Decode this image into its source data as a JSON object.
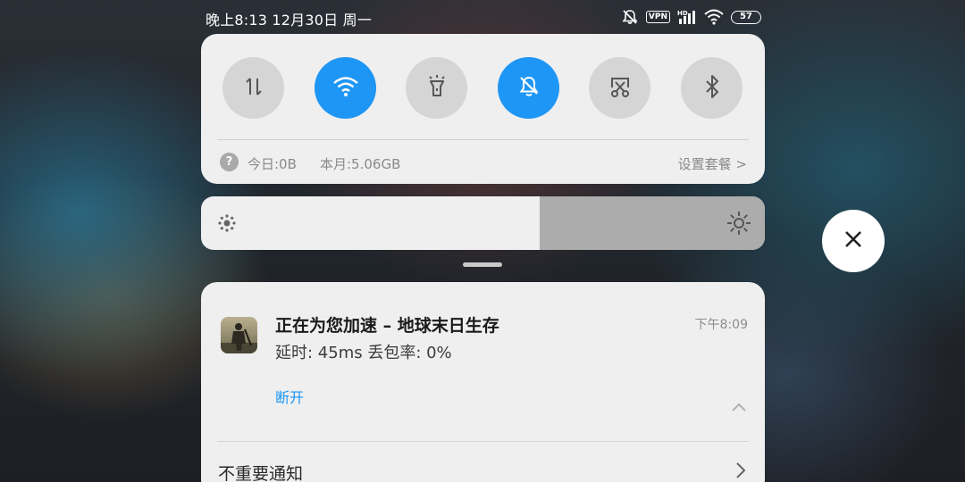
{
  "status_bar": {
    "time_date": "晚上8:13 12月30日 周一",
    "vpn_label": "VPN",
    "signal_label": "HD",
    "battery_level": "57",
    "icons": [
      "mute-icon",
      "vpn-icon",
      "cellular-signal-icon",
      "wifi-icon",
      "battery-icon"
    ]
  },
  "quick_settings": {
    "tiles": [
      {
        "name": "mobile-data",
        "icon": "data-arrows-icon",
        "active": false
      },
      {
        "name": "wifi",
        "icon": "wifi-icon",
        "active": true
      },
      {
        "name": "flashlight",
        "icon": "flashlight-icon",
        "active": false
      },
      {
        "name": "silent",
        "icon": "bell-off-icon",
        "active": true
      },
      {
        "name": "screenshot",
        "icon": "scissors-icon",
        "active": false
      },
      {
        "name": "bluetooth",
        "icon": "bluetooth-icon",
        "active": false
      }
    ],
    "data_usage": {
      "help_glyph": "?",
      "today": "今日:0B",
      "month": "本月:5.06GB",
      "plan_link": "设置套餐 >"
    }
  },
  "brightness": {
    "level": 0.6
  },
  "notification": {
    "title": "正在为您加速 – 地球末日生存",
    "time": "下午8:09",
    "body": "延时: 45ms 丢包率: 0%",
    "action": "断开"
  },
  "unimportant": {
    "label": "不重要通知"
  },
  "colors": {
    "accent": "#1e96f5",
    "tile_inactive": "#d5d5d5",
    "panel": "#efefef"
  }
}
